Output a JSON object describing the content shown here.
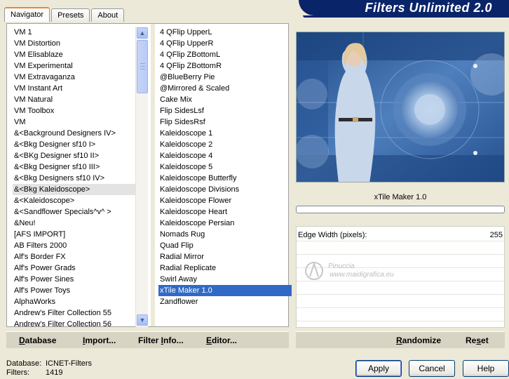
{
  "window": {
    "title": "Filters Unlimited 2.0"
  },
  "tabs": [
    {
      "label": "Navigator",
      "active": true
    },
    {
      "label": "Presets",
      "active": false
    },
    {
      "label": "About",
      "active": false
    }
  ],
  "categories": [
    "VM 1",
    "VM Distortion",
    "VM Elisablaze",
    "VM Experimental",
    "VM Extravaganza",
    "VM Instant Art",
    "VM Natural",
    "VM Toolbox",
    "VM",
    "&<Background Designers IV>",
    "&<Bkg Designer sf10 I>",
    "&<BKg Designer sf10 II>",
    "&<Bkg Designer sf10 III>",
    "&<Bkg Designers sf10 IV>",
    "&<Bkg Kaleidoscope>",
    "&<Kaleidoscope>",
    "&<Sandflower Specials^v^ >",
    "&Neu!",
    "[AFS IMPORT]",
    "AB Filters 2000",
    "Alf's Border FX",
    "Alf's Power Grads",
    "Alf's Power Sines",
    "Alf's Power Toys",
    "AlphaWorks",
    "Andrew's Filter Collection 55",
    "Andrew's Filter Collection 56"
  ],
  "selected_category": "&<Bkg Kaleidoscope>",
  "filters": [
    "4 QFlip UpperL",
    "4 QFlip UpperR",
    "4 QFlip ZBottomL",
    "4 QFlip ZBottomR",
    "@BlueBerry Pie",
    "@Mirrored & Scaled",
    "Cake Mix",
    "Flip SidesLsf",
    "Flip SidesRsf",
    "Kaleidoscope 1",
    "Kaleidoscope 2",
    "Kaleidoscope 4",
    "Kaleidoscope 5",
    "Kaleidoscope Butterfly",
    "Kaleidoscope Divisions",
    "Kaleidoscope Flower",
    "Kaleidoscope Heart",
    "Kaleidoscope Persian",
    "Nomads Rug",
    "Quad Flip",
    "Radial Mirror",
    "Radial Replicate",
    "Swirl Away",
    "xTile Maker 1.0",
    "Zandflower"
  ],
  "selected_filter": "xTile Maker 1.0",
  "preview": {
    "filter_name": "xTile Maker 1.0"
  },
  "params": [
    {
      "label": "Edge Width (pixels):",
      "value": "255"
    }
  ],
  "watermark": {
    "name": "Pinuccia",
    "url": "www.maidigrafica.eu"
  },
  "toolbar": {
    "database_u": "D",
    "database_rest": "atabase",
    "import_u": "I",
    "import_rest": "mport...",
    "filter_info_pre": "Filter ",
    "filter_info_u": "I",
    "filter_info_rest": "nfo...",
    "editor_u": "E",
    "editor_rest": "ditor...",
    "randomize_u": "R",
    "randomize_rest": "andomize",
    "reset_pre": "Re",
    "reset_u": "s",
    "reset_rest": "et"
  },
  "status": {
    "database_label": "Database:",
    "database_value": "ICNET-Filters",
    "filters_label": "Filters:",
    "filters_value": "1419"
  },
  "buttons": {
    "apply": "Apply",
    "cancel": "Cancel",
    "help": "Help"
  },
  "colors": {
    "selection": "#316ac5",
    "title_bar": "#0a246a",
    "tab_accent": "#e68b2c"
  }
}
